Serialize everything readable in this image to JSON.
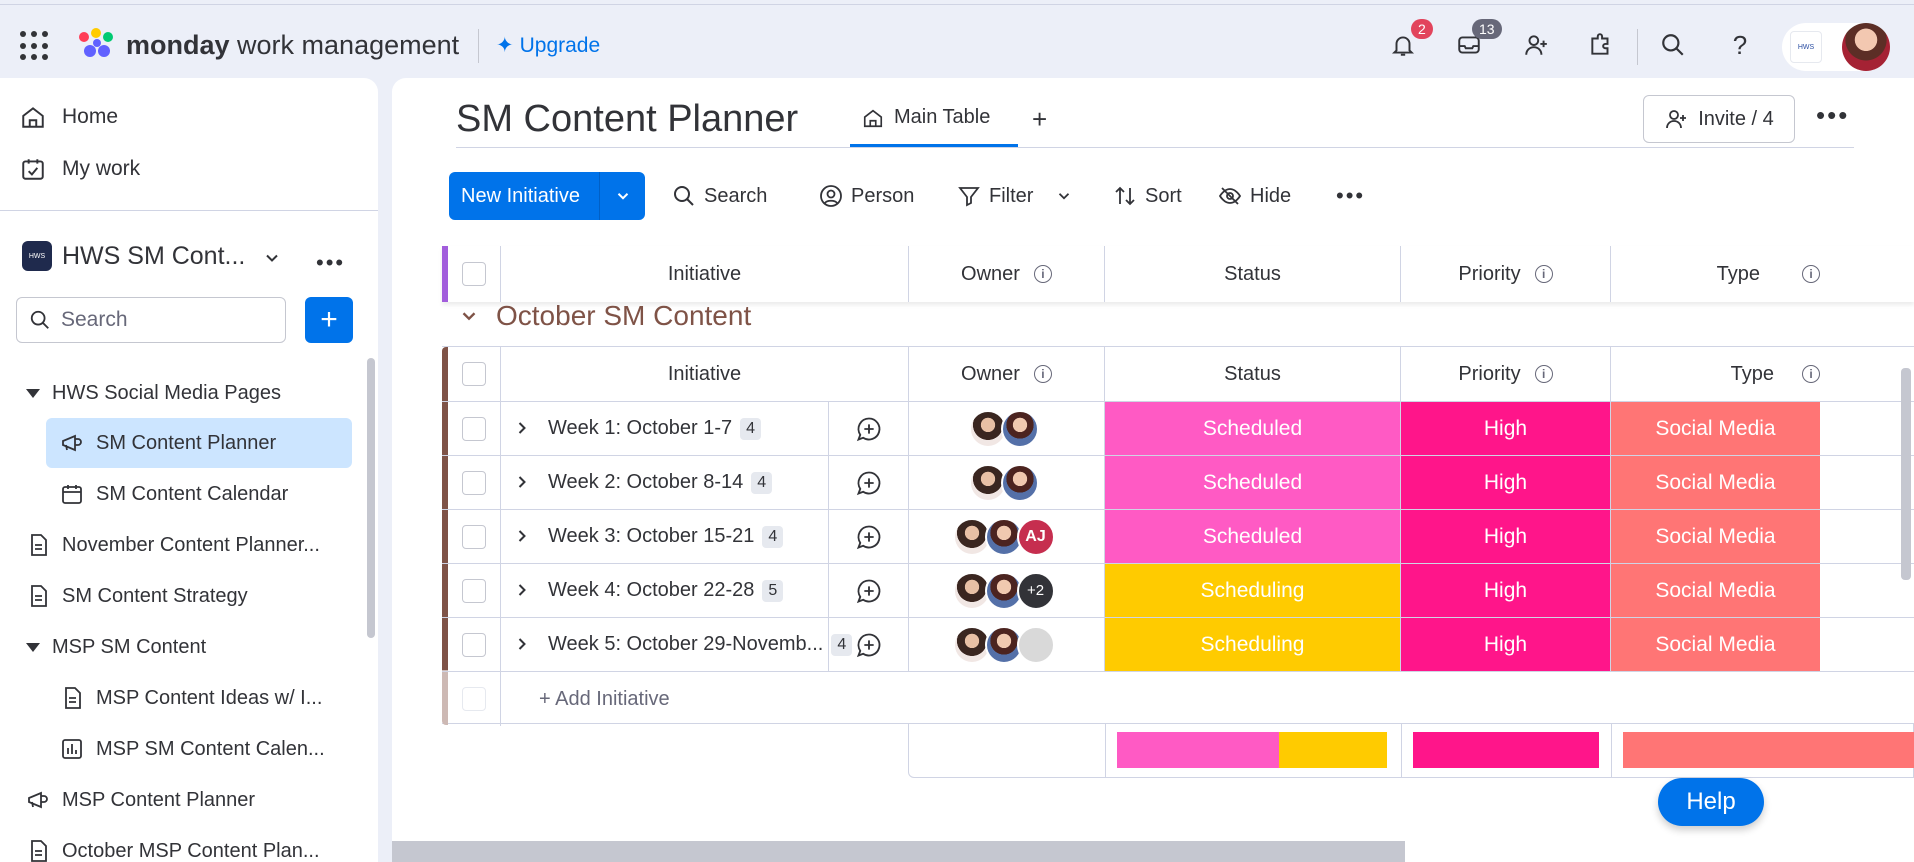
{
  "topbar": {
    "brand_bold": "monday",
    "brand_rest": " work management",
    "upgrade_label": "Upgrade",
    "notifications_count": "2",
    "inbox_count": "13",
    "account_logo_text": "HWS"
  },
  "sidebar": {
    "home_label": "Home",
    "mywork_label": "My work",
    "workspace_name": "HWS SM Cont...",
    "search_placeholder": "Search",
    "tree": [
      {
        "label": "HWS Social Media Pages"
      },
      {
        "label": "SM Content Planner"
      },
      {
        "label": "SM Content Calendar"
      },
      {
        "label": "November Content Planner..."
      },
      {
        "label": "SM Content Strategy"
      },
      {
        "label": "MSP SM Content"
      },
      {
        "label": "MSP Content Ideas w/ I..."
      },
      {
        "label": "MSP SM Content Calen..."
      },
      {
        "label": "MSP Content Planner"
      },
      {
        "label": "October MSP Content Plan..."
      }
    ]
  },
  "board": {
    "title": "SM Content Planner",
    "tab_main": "Main Table",
    "tab_add": "+",
    "invite_label": "Invite / 4",
    "toolbar": {
      "new_label": "New Initiative",
      "search_label": "Search",
      "person_label": "Person",
      "filter_label": "Filter",
      "sort_label": "Sort",
      "hide_label": "Hide"
    },
    "columns": {
      "initiative": "Initiative",
      "owner": "Owner",
      "status": "Status",
      "priority": "Priority",
      "type": "Type"
    },
    "group": {
      "title": "October SM Content",
      "rows": [
        {
          "name": "Week 1: October 1-7",
          "count": "4",
          "status": "Scheduled",
          "priority": "High",
          "type": "Social Media"
        },
        {
          "name": "Week 2: October 8-14",
          "count": "4",
          "status": "Scheduled",
          "priority": "High",
          "type": "Social Media"
        },
        {
          "name": "Week 3: October 15-21",
          "count": "4",
          "status": "Scheduled",
          "priority": "High",
          "type": "Social Media",
          "extra_owner": "AJ"
        },
        {
          "name": "Week 4: October 22-28",
          "count": "5",
          "status": "Scheduling",
          "priority": "High",
          "type": "Social Media",
          "extra_owner": "+2"
        },
        {
          "name": "Week 5: October 29-Novemb...",
          "count": "4",
          "status": "Scheduling",
          "priority": "High",
          "type": "Social Media"
        }
      ],
      "add_label": "+ Add Initiative"
    },
    "summary": {
      "status_scheduled_fraction": 0.6,
      "status_scheduling_fraction": 0.4
    }
  },
  "colors": {
    "accent": "#0073ea",
    "scheduled": "#ff5ac4",
    "scheduling": "#ffcb00",
    "high": "#ff158a",
    "social_media": "#ff7575",
    "group_bar": "#7f5347"
  },
  "help_label": "Help"
}
